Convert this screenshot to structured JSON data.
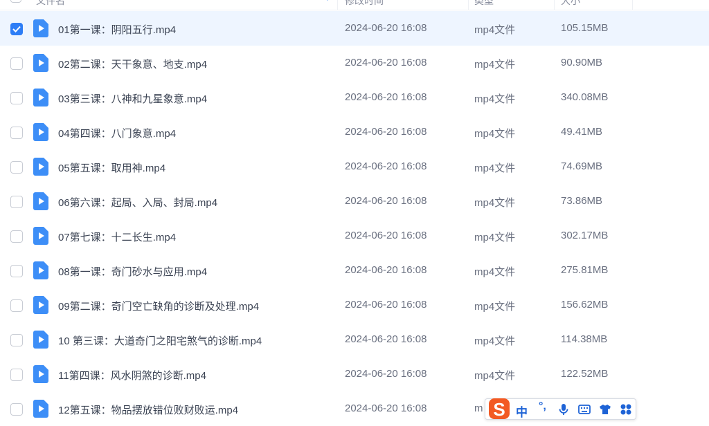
{
  "header": {
    "columns": [
      "文件名",
      "修改时间",
      "类型",
      "大小"
    ]
  },
  "files": [
    {
      "name": "01第一课：阴阳五行.mp4",
      "date": "2024-06-20 16:08",
      "type": "mp4文件",
      "size": "105.15MB",
      "checked": true
    },
    {
      "name": "02第二课：天干象意、地支.mp4",
      "date": "2024-06-20 16:08",
      "type": "mp4文件",
      "size": "90.90MB",
      "checked": false
    },
    {
      "name": "03第三课：八神和九星象意.mp4",
      "date": "2024-06-20 16:08",
      "type": "mp4文件",
      "size": "340.08MB",
      "checked": false
    },
    {
      "name": "04第四课：八门象意.mp4",
      "date": "2024-06-20 16:08",
      "type": "mp4文件",
      "size": "49.41MB",
      "checked": false
    },
    {
      "name": "05第五课：取用神.mp4",
      "date": "2024-06-20 16:08",
      "type": "mp4文件",
      "size": "74.69MB",
      "checked": false
    },
    {
      "name": "06第六课：起局、入局、封局.mp4",
      "date": "2024-06-20 16:08",
      "type": "mp4文件",
      "size": "73.86MB",
      "checked": false
    },
    {
      "name": "07第七课：十二长生.mp4",
      "date": "2024-06-20 16:08",
      "type": "mp4文件",
      "size": "302.17MB",
      "checked": false
    },
    {
      "name": "08第一课：奇门砂水与应用.mp4",
      "date": "2024-06-20 16:08",
      "type": "mp4文件",
      "size": "275.81MB",
      "checked": false
    },
    {
      "name": "09第二课：奇门空亡缺角的诊断及处理.mp4",
      "date": "2024-06-20 16:08",
      "type": "mp4文件",
      "size": "156.62MB",
      "checked": false
    },
    {
      "name": "10  第三课：大道奇门之阳宅煞气的诊断.mp4",
      "date": "2024-06-20 16:08",
      "type": "mp4文件",
      "size": "114.38MB",
      "checked": false
    },
    {
      "name": "11第四课：风水阴煞的诊断.mp4",
      "date": "2024-06-20 16:08",
      "type": "mp4文件",
      "size": "122.52MB",
      "checked": false
    },
    {
      "name": "12第五课：物品摆放错位败财败运.mp4",
      "date": "2024-06-20 16:08",
      "type": "m",
      "size": "",
      "checked": false
    }
  ],
  "ime": {
    "mode_label": "中",
    "punct_label": "°,"
  },
  "colors": {
    "accent": "#2d7df6",
    "selected_row": "#eef5ff",
    "file_icon": "#3d8ef7",
    "ime_logo": "#f25a24"
  }
}
